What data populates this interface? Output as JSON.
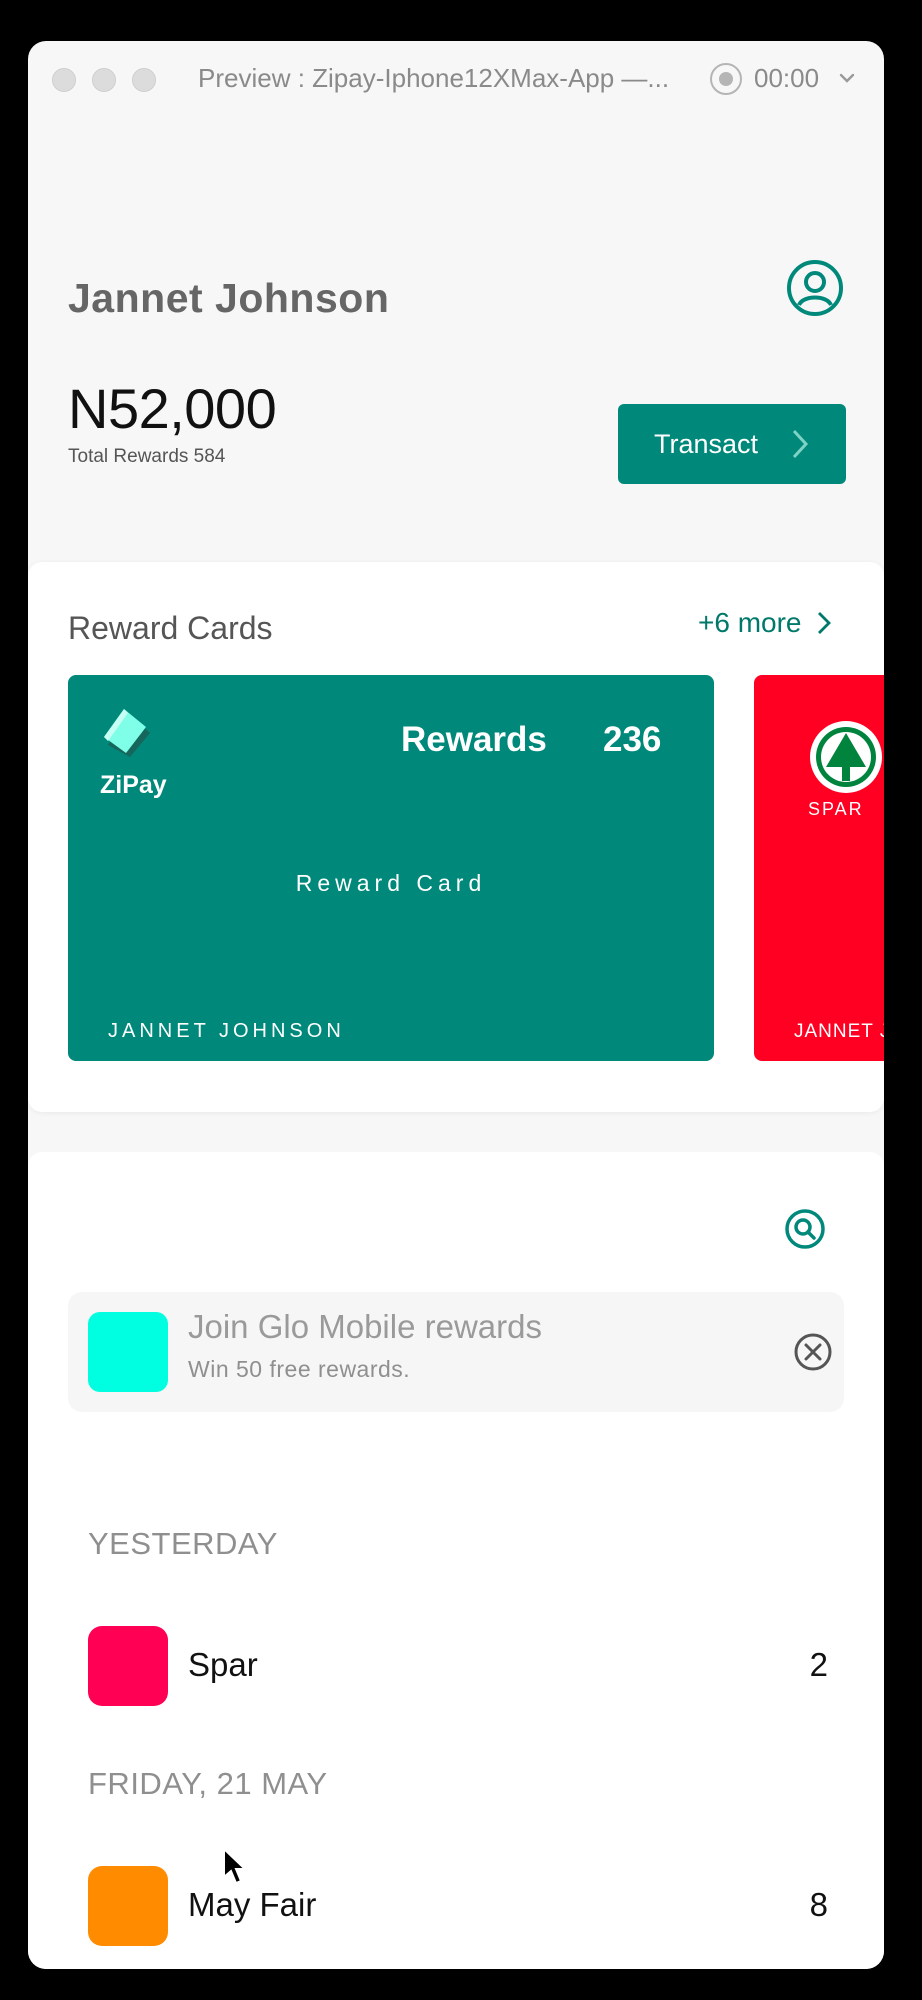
{
  "window": {
    "title": "Preview : Zipay-Iphone12XMax-App —...",
    "timer": "00:00"
  },
  "header": {
    "user_name": "Jannet Johnson",
    "balance": "N52,000",
    "total_rewards": "Total Rewards 584",
    "transact_label": "Transact"
  },
  "reward_cards": {
    "title": "Reward Cards",
    "more_label": "+6 more",
    "cards": [
      {
        "brand": "ZiPay",
        "rewards_label": "Rewards",
        "rewards_value": "236",
        "card_type": "Reward Card",
        "holder": "JANNET JOHNSON",
        "color": "#00897b"
      },
      {
        "brand": "SPAR",
        "holder": "JANNET J",
        "color": "#ff0022"
      }
    ]
  },
  "promo": {
    "title": "Join Glo Mobile rewards",
    "subtitle": "Win 50 free  rewards."
  },
  "transactions": [
    {
      "section": "YESTERDAY",
      "items": [
        {
          "name": "Spar",
          "points": "2",
          "color": "#ff0055"
        }
      ]
    },
    {
      "section": "FRIDAY, 21 MAY",
      "items": [
        {
          "name": "May Fair",
          "points": "8",
          "color": "#ff8c00"
        }
      ]
    }
  ],
  "colors": {
    "accent": "#00897b",
    "background": "#f7f7f7"
  }
}
